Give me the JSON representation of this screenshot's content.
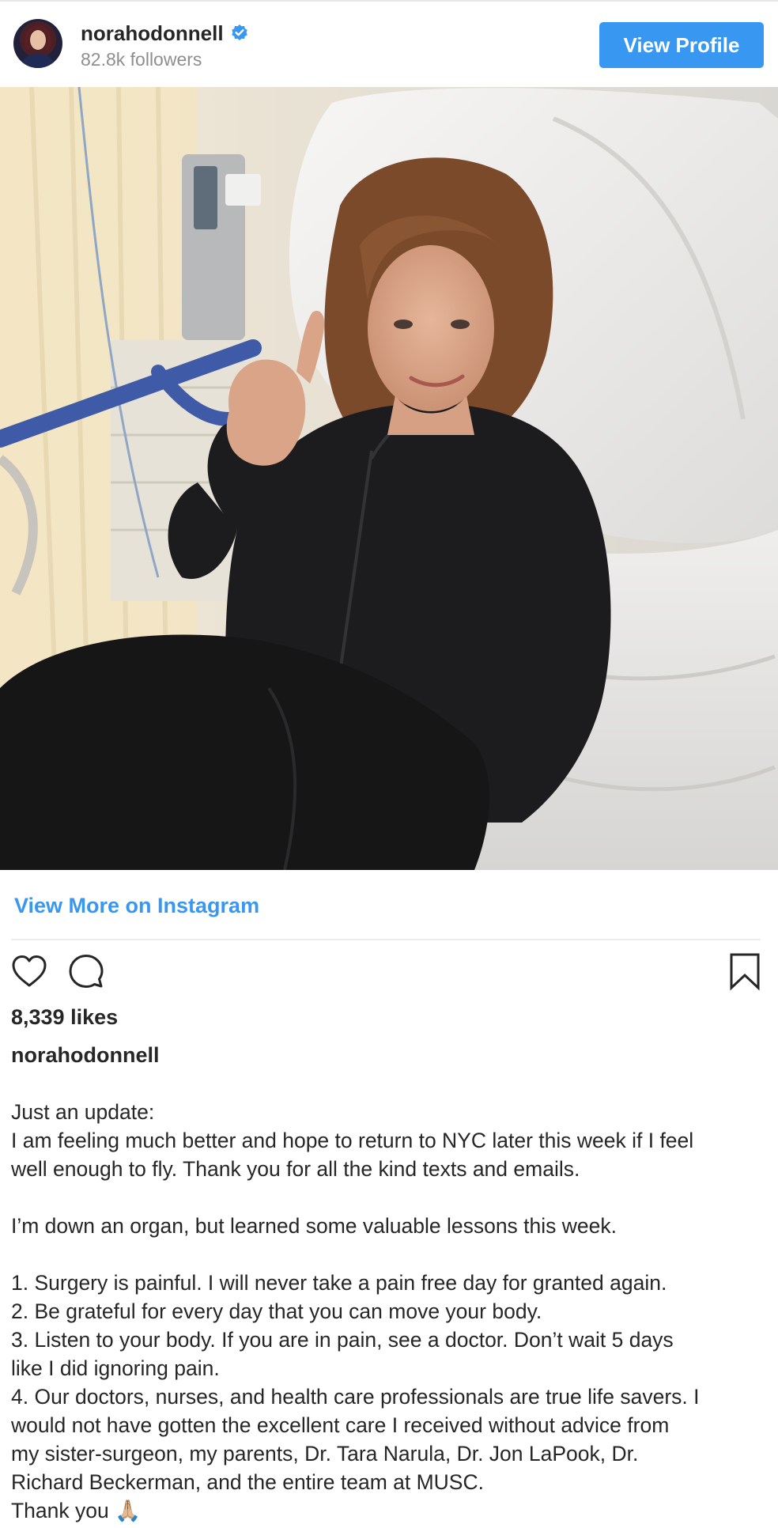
{
  "header": {
    "username": "norahodonnell",
    "verified_icon": "verified-badge-icon",
    "followers": "82.8k followers",
    "view_profile_label": "View Profile"
  },
  "colors": {
    "accent": "#3897f0",
    "text": "#262626",
    "muted": "#8e8e8e"
  },
  "post": {
    "image_alt_subject": "photo",
    "view_more_label": "View More on Instagram",
    "actions": {
      "like_icon": "heart-icon",
      "comment_icon": "comment-icon",
      "save_icon": "bookmark-icon"
    },
    "likes": "8,339 likes",
    "caption_username": "norahodonnell",
    "caption_lines": [
      "Just an update:",
      "I am feeling much better and hope to return to NYC later this week if I feel",
      "well enough to fly. Thank you for all the kind texts and emails.",
      "",
      "I’m down an organ, but learned some valuable lessons this week.",
      "",
      "1. Surgery is painful. I will never take a pain free day for granted again.",
      "2. Be grateful for every day that you can move your body.",
      "3. Listen to your body. If you are in pain, see a doctor. Don’t wait 5 days",
      "like I did ignoring pain.",
      "4. Our doctors, nurses, and health care professionals are true life savers. I",
      "would not have gotten the excellent care I received without advice from",
      "my sister-surgeon, my parents, Dr. Tara Narula, Dr. Jon LaPook, Dr.",
      "Richard Beckerman, and the entire team at MUSC.",
      "Thank you 🙏🏼"
    ]
  }
}
